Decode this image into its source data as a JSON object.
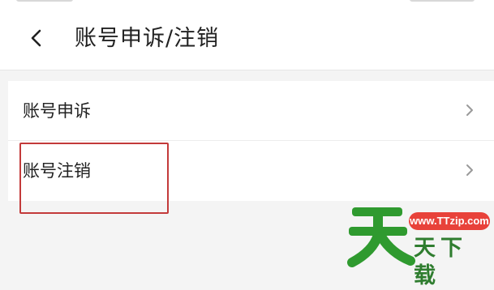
{
  "header": {
    "title": "账号申诉/注销",
    "back_icon": "chevron-left-icon"
  },
  "list": {
    "items": [
      {
        "label": "账号申诉",
        "icon": "chevron-right-icon"
      },
      {
        "label": "账号注销",
        "icon": "chevron-right-icon"
      }
    ]
  },
  "highlight": {
    "color": "#c33a3a"
  },
  "watermark": {
    "url": "www.TTzip.com",
    "name": "天下载",
    "colors": {
      "logo": "#2f9a2f",
      "badge": "#e8423a"
    }
  }
}
